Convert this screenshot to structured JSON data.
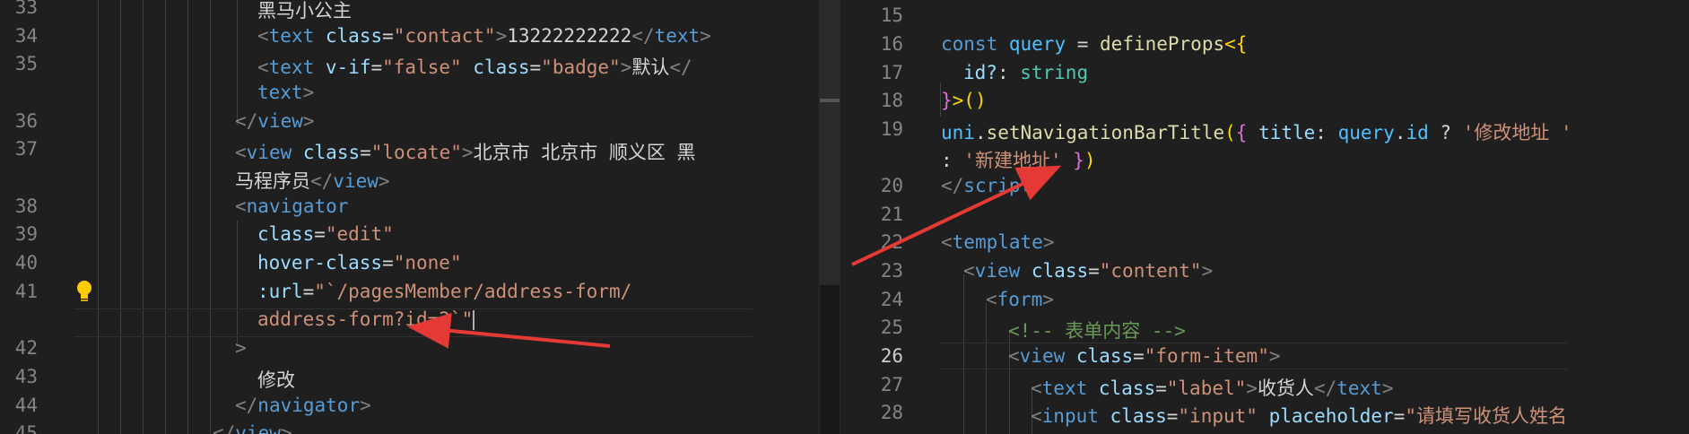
{
  "left": {
    "line_numbers": [
      "33",
      "34",
      "35",
      "",
      "36",
      "37",
      "",
      "38",
      "39",
      "40",
      "41",
      "",
      "42",
      "43",
      "44",
      "45"
    ],
    "code": {
      "l33": "黑马小公主",
      "l34_attr_value": "\"contact\"",
      "l34_text": "13222222222",
      "l35_vif": "\"false\"",
      "l35_class": "\"badge\"",
      "l35_text": "默认",
      "l35_wrap": "text",
      "l37_class": "\"locate\"",
      "l37_text": "北京市 北京市 顺义区 黑",
      "l37_wrap": "马程序员",
      "l39_class": "\"edit\"",
      "l40_hover": "\"none\"",
      "l41_url": "\"`/pagesMember/address-form/",
      "l41_wrap": "address-form?id=2`\"",
      "l43_text": "修改"
    }
  },
  "right": {
    "line_numbers": [
      "15",
      "16",
      "17",
      "18",
      "19",
      "",
      "20",
      "21",
      "22",
      "23",
      "24",
      "25",
      "26",
      "27",
      "28"
    ],
    "active_line": "26",
    "code": {
      "l16_var": "query",
      "l16_fn": "defineProps",
      "l17_prop": "id?",
      "l17_type": "string",
      "l19_obj": "uni",
      "l19_fn": "setNavigationBarTitle",
      "l19_key": "title",
      "l19_query": "query",
      "l19_id": "id",
      "l19_str1": "'修改地址 '",
      "l19_str2": "'新建地址'",
      "l23_class": "\"content\"",
      "l25_comment": "<!-- 表单内容 -->",
      "l26_class": "\"form-item\"",
      "l27_class": "\"label\"",
      "l27_text": "收货人",
      "l28_class": "\"input\"",
      "l28_placeholder": "\"请填写收货人姓名"
    }
  },
  "colors": {
    "background": "#1f1f1f",
    "arrow": "#e53935"
  }
}
